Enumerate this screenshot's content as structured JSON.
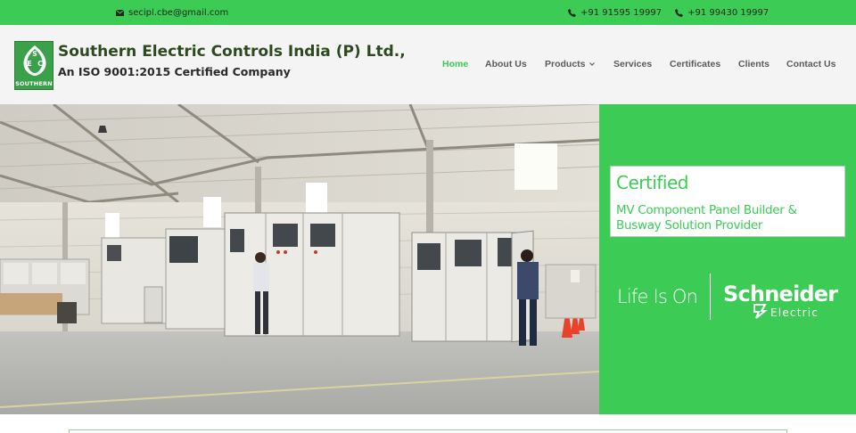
{
  "topbar": {
    "email": "secipl.cbe@gmail.com",
    "phone1": "+91 91595 19997",
    "phone2": "+91 99430 19997",
    "bg_color": "#3ccb55"
  },
  "header": {
    "logo_letters": [
      "S",
      "E",
      "C"
    ],
    "logo_caption": "SOUTHERN",
    "company_name": "Southern Electric Controls India (P) Ltd.,",
    "certification": "An ISO 9001:2015 Certified Company"
  },
  "nav": {
    "items": [
      {
        "label": "Home",
        "active": true
      },
      {
        "label": "About Us"
      },
      {
        "label": "Products",
        "has_dropdown": true
      },
      {
        "label": "Services"
      },
      {
        "label": "Certificates"
      },
      {
        "label": "Clients"
      },
      {
        "label": "Contact Us"
      }
    ],
    "accent_color": "#3ccb55"
  },
  "hero": {
    "cert_title": "Certified",
    "cert_text": "MV Component Panel Builder & Busway Solution Provider",
    "tagline": "Life Is On",
    "brand": "Schneider",
    "brand_sub": "Electric"
  }
}
